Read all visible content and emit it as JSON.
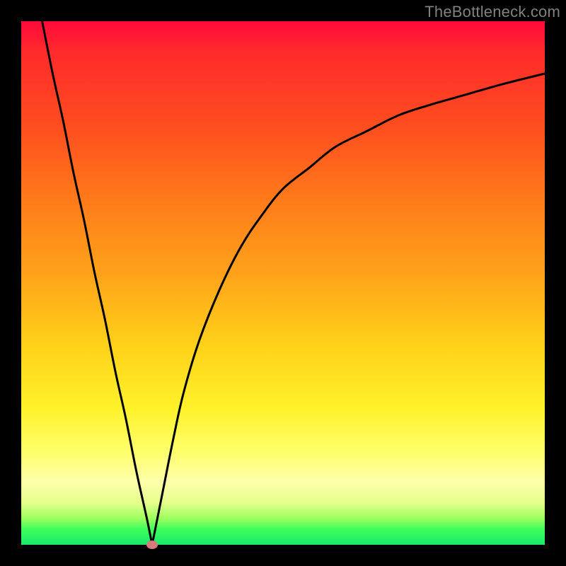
{
  "watermark": "TheBottleneck.com",
  "colors": {
    "frame": "#000000",
    "watermark": "#808080",
    "curve": "#000000",
    "marker": "#d87a7a",
    "gradient_top": "#ff0a3a",
    "gradient_bottom": "#17e86b"
  },
  "chart_data": {
    "type": "line",
    "title": "",
    "xlabel": "",
    "ylabel": "",
    "xlim": [
      0,
      100
    ],
    "ylim": [
      0,
      100
    ],
    "grid": false,
    "legend": false,
    "annotations": {
      "watermark": "TheBottleneck.com"
    },
    "series": [
      {
        "name": "left-branch",
        "x": [
          4,
          6,
          8,
          10,
          12,
          14,
          16,
          18,
          20,
          22,
          24,
          25
        ],
        "values": [
          100,
          90,
          81,
          71,
          62,
          52,
          43,
          33,
          24,
          14,
          5,
          0
        ]
      },
      {
        "name": "right-branch",
        "x": [
          25,
          27,
          29,
          31,
          34,
          38,
          42,
          46,
          50,
          55,
          60,
          66,
          72,
          78,
          85,
          92,
          100
        ],
        "values": [
          0,
          10,
          20,
          29,
          39,
          49,
          57,
          63,
          68,
          72,
          76,
          79,
          82,
          84,
          86,
          88,
          90
        ]
      }
    ],
    "marker": {
      "x": 25,
      "y": 0
    }
  }
}
